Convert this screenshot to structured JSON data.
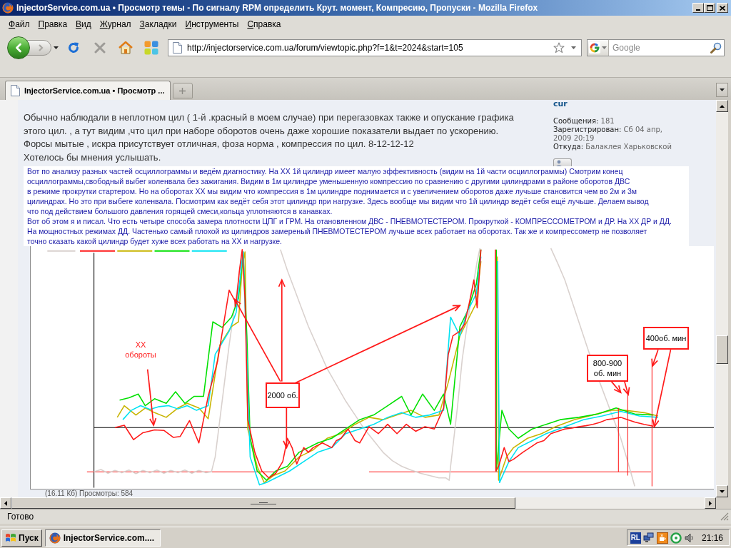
{
  "window": {
    "title": "InjectorService.com.ua • Просмотр темы - По сигналу RPM определить Крут. момент, Компресию, Пропуски - Mozilla Firefox"
  },
  "menu": [
    {
      "label": "Файл"
    },
    {
      "label": "Правка"
    },
    {
      "label": "Вид"
    },
    {
      "label": "Журнал"
    },
    {
      "label": "Закладки"
    },
    {
      "label": "Инструменты"
    },
    {
      "label": "Справка"
    }
  ],
  "toolbar": {
    "url": "http://injectorservice.com.ua/forum/viewtopic.php?f=1&t=2024&start=105",
    "search": {
      "placeholder": "Google"
    }
  },
  "tabs": [
    {
      "label": "InjectorService.com.ua • Просмотр ...",
      "selected": true
    }
  ],
  "post": {
    "lines": [
      "Обычно наблюдали в неплотном цил ( 1-й .красный в моем случае) при перегазовках также и опускание графика",
      "этого цил. , а тут видим ,что цил при наборе оборотов очень даже хорошие показатели выдает по ускорению.",
      "Форсы мытые , искра присутствует отличная, фоза норма , компрессия по цил. 8-12-12-12",
      "Хотелось бы мнения услышать."
    ]
  },
  "profile": {
    "username": "cur",
    "fields": [
      {
        "label": "Сообщения:",
        "value": "181"
      },
      {
        "label": "Зарегистрирован:",
        "value": "Сб 04 апр, 2009 20:19"
      },
      {
        "label": "Откуда:",
        "value": "Балаклея Харьковской"
      }
    ]
  },
  "image": {
    "paragraphs": [
      {
        "lines": [
          "Вот по анализу разных частей осциллограммы и ведём диагностику. На ХХ 1й цилиндр имеет малую эффективность (видим на 1й части осциллограммы) Смотрим конец",
          "осциллограммы,свободный выбег коленвала без зажигания. Видим в 1м цилиндре уменьшенную компрессию по сравнению с другими цилиндрами в районе оборотов ДВС",
          "в режиме прокрутки стартером. Но на оборотах ХХ мы видим что компрессия в 1м цилиндре поднимается и с увеличением оборотов даже лучьше становится чем во 2м и 3м",
          "цилиндрах. Но это при выбеге коленвала. Посмотрим как ведёт себя этот цилиндр при нагрузке. Здесь вообще мы видим что 1й цилиндр ведёт себя ещё лучьше. Делаем вывод",
          "что под действием большого давления горящей смеси,кольца уплотняются в канавках."
        ]
      },
      {
        "lines": [
          "Вот об этом я и писал. Что есть четыре способа замера плотности ЦПГ и ГРМ. На отановленном ДВС - ПНЕВМОТЕСТЕРОМ. Прокруткой - КОМПРЕССОМЕТРОМ и ДР. На ХХ ДР и ДД.",
          "На мощностных режимах ДД. Частенько самый плохой из цилиндров замереный ПНЕВМОТЕСТЕРОМ лучьше всех работает на оборотах. Так же и компрессометр не позволяет",
          "точно сказать какой цилиндр будет хуже всех работать на ХХ и нагрузке."
        ]
      }
    ],
    "annotations": [
      {
        "kind": "plain",
        "lines": [
          "ХХ",
          "обороты"
        ]
      },
      {
        "kind": "boxed",
        "lines": [
          "2000 об."
        ]
      },
      {
        "kind": "boxed",
        "lines": [
          "800-900",
          "об. мин"
        ]
      },
      {
        "kind": "boxed",
        "lines": [
          "400об. мин"
        ]
      }
    ]
  },
  "attachment": {
    "caption": "(16.11 Кб) Просмотры: 584"
  },
  "status_bar": {
    "text": "Готово"
  },
  "taskbar": {
    "start_label": "Пуск",
    "tasks": [
      {
        "label": "InjectorService.com....",
        "selected": true
      }
    ],
    "tray": {
      "indicator": "RL",
      "clock": "21:16"
    }
  }
}
